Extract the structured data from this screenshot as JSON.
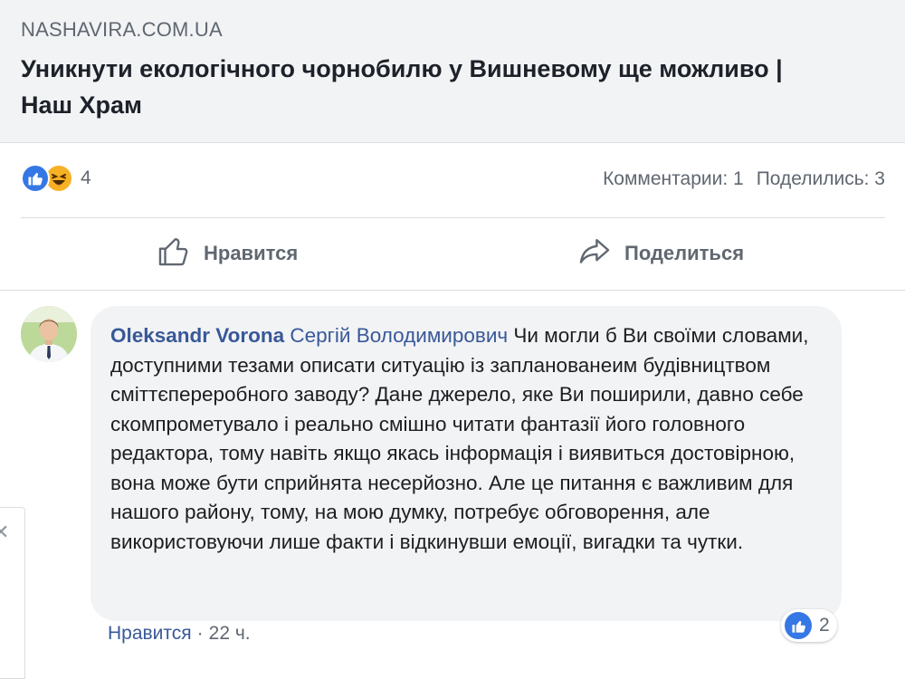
{
  "link_preview": {
    "domain": "NASHAVIRA.COM.UA",
    "title": "Уникнути екологічного чорнобилю у Вишневому ще можливо | Наш Храм"
  },
  "post_stats": {
    "reaction_icons": [
      "like-icon",
      "haha-icon"
    ],
    "reaction_count": "4",
    "comments_label": "Комментарии: 1",
    "shares_label": "Поделились: 3"
  },
  "actions": {
    "like_label": "Нравится",
    "share_label": "Поделиться"
  },
  "comment": {
    "author": "Oleksandr Vorona",
    "mention": "Сергій Володимирович",
    "text": "Чи могли б Ви своїми словами, доступними тезами описати ситуацію із запланованеим будівництвом сміттєпереробного заводу? Дане джерело, яке Ви поширили, давно себе скомпрометувало і реально смішно читати фантазії його головного редактора, тому навіть якщо якась інформація і виявиться достовірною, вона може бути сприйнята несерйозно. Але це питання є важливим для нашого району, тому, на мою думку, потребує обговорення, але використовуючи лише факти і відкинувши емоції, вигадки та чутки.",
    "reaction_count": "2",
    "like_link": "Нравится",
    "separator": "·",
    "time": "22 ч."
  },
  "colors": {
    "link_blue": "#385898",
    "like_blue": "#3578e5",
    "haha_yellow": "#f7b125",
    "secondary_text": "#606770",
    "preview_bg": "#f2f3f5"
  }
}
